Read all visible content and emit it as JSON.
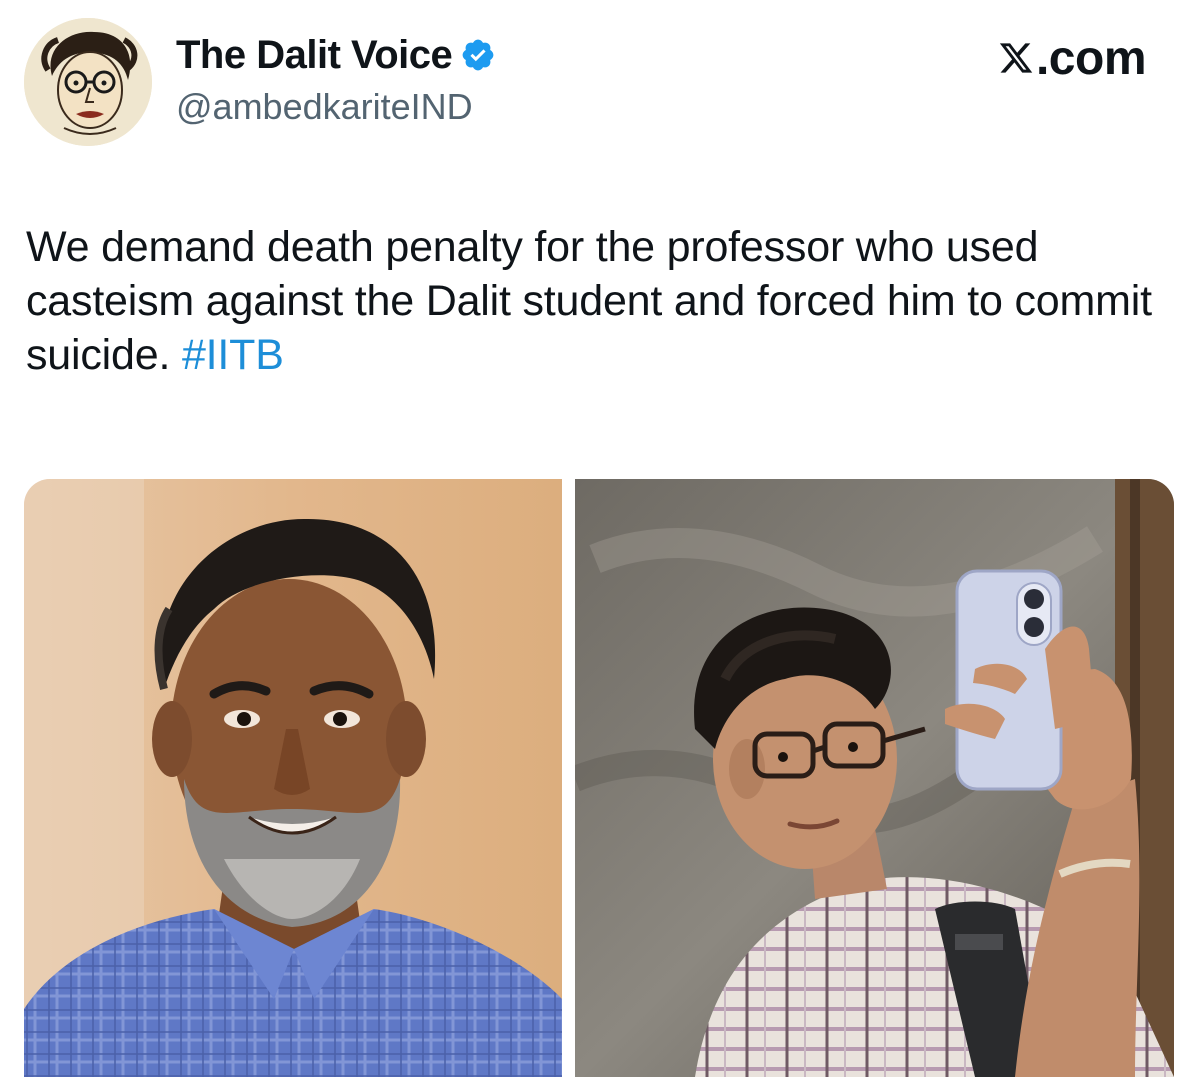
{
  "tweet": {
    "author": {
      "display_name": "The Dalit Voice",
      "handle": "@ambedkariteIND",
      "verified": true,
      "verified_color": "#1d9bf0"
    },
    "brand": {
      "suffix": ".com"
    },
    "text": {
      "body": "We demand death penalty for the professor who used casteism against the Dalit student and forced him to commit suicide. ",
      "hashtag": "#IITB",
      "hashtag_color": "#1d8ed8"
    },
    "media": [
      {
        "icon": "photo-professor"
      },
      {
        "icon": "photo-student-selfie"
      }
    ]
  }
}
